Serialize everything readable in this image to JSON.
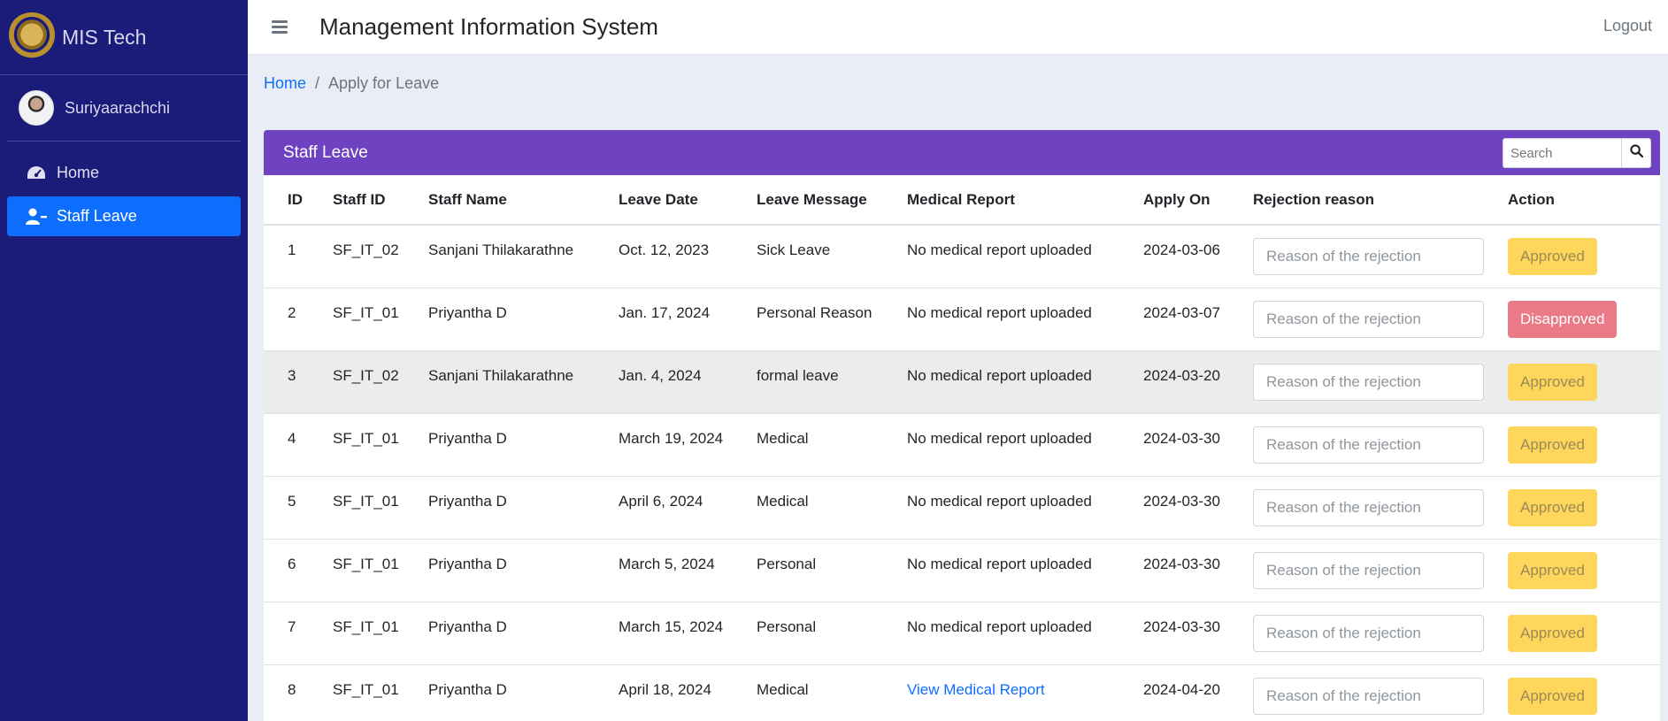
{
  "brand": {
    "name": "MIS Tech"
  },
  "user": {
    "name": "Suriyaarachchi"
  },
  "sidebar": {
    "items": [
      {
        "label": "Home"
      },
      {
        "label": "Staff Leave"
      }
    ]
  },
  "header": {
    "title": "Management Information System",
    "logout": "Logout"
  },
  "breadcrumb": {
    "home": "Home",
    "separator": "/",
    "current": "Apply for Leave"
  },
  "card": {
    "title": "Staff Leave",
    "search_placeholder": "Search",
    "columns": [
      "ID",
      "Staff ID",
      "Staff Name",
      "Leave Date",
      "Leave Message",
      "Medical Report",
      "Apply On",
      "Rejection reason",
      "Action"
    ],
    "reason_placeholder": "Reason of the rejection",
    "rows": [
      {
        "id": "1",
        "staff_id": "SF_IT_02",
        "name": "Sanjani Thilakarathne",
        "date": "Oct. 12, 2023",
        "message": "Sick Leave",
        "medical": "No medical report uploaded",
        "apply_on": "2024-03-06",
        "action": "Approved"
      },
      {
        "id": "2",
        "staff_id": "SF_IT_01",
        "name": "Priyantha D",
        "date": "Jan. 17, 2024",
        "message": "Personal Reason",
        "medical": "No medical report uploaded",
        "apply_on": "2024-03-07",
        "action": "Disapproved"
      },
      {
        "id": "3",
        "staff_id": "SF_IT_02",
        "name": "Sanjani Thilakarathne",
        "date": "Jan. 4, 2024",
        "message": "formal leave",
        "medical": "No medical report uploaded",
        "apply_on": "2024-03-20",
        "action": "Approved"
      },
      {
        "id": "4",
        "staff_id": "SF_IT_01",
        "name": "Priyantha D",
        "date": "March 19, 2024",
        "message": "Medical",
        "medical": "No medical report uploaded",
        "apply_on": "2024-03-30",
        "action": "Approved"
      },
      {
        "id": "5",
        "staff_id": "SF_IT_01",
        "name": "Priyantha D",
        "date": "April 6, 2024",
        "message": "Medical",
        "medical": "No medical report uploaded",
        "apply_on": "2024-03-30",
        "action": "Approved"
      },
      {
        "id": "6",
        "staff_id": "SF_IT_01",
        "name": "Priyantha D",
        "date": "March 5, 2024",
        "message": "Personal",
        "medical": "No medical report uploaded",
        "apply_on": "2024-03-30",
        "action": "Approved"
      },
      {
        "id": "7",
        "staff_id": "SF_IT_01",
        "name": "Priyantha D",
        "date": "March 15, 2024",
        "message": "Personal",
        "medical": "No medical report uploaded",
        "apply_on": "2024-03-30",
        "action": "Approved"
      },
      {
        "id": "8",
        "staff_id": "SF_IT_01",
        "name": "Priyantha D",
        "date": "April 18, 2024",
        "message": "Medical",
        "medical": "View Medical Report",
        "apply_on": "2024-04-20",
        "action": "Approved"
      }
    ]
  },
  "colors": {
    "sidebar_bg": "#1b1b7a",
    "active_nav": "#0d6efd",
    "card_header": "#6f42c1",
    "approved": "#ffd65c",
    "disapproved": "#e97a86",
    "link": "#0d6efd"
  },
  "icons": {
    "menu": "hamburger-icon",
    "home": "tachometer-icon",
    "staff_leave": "user-minus-icon",
    "search": "search-icon"
  }
}
